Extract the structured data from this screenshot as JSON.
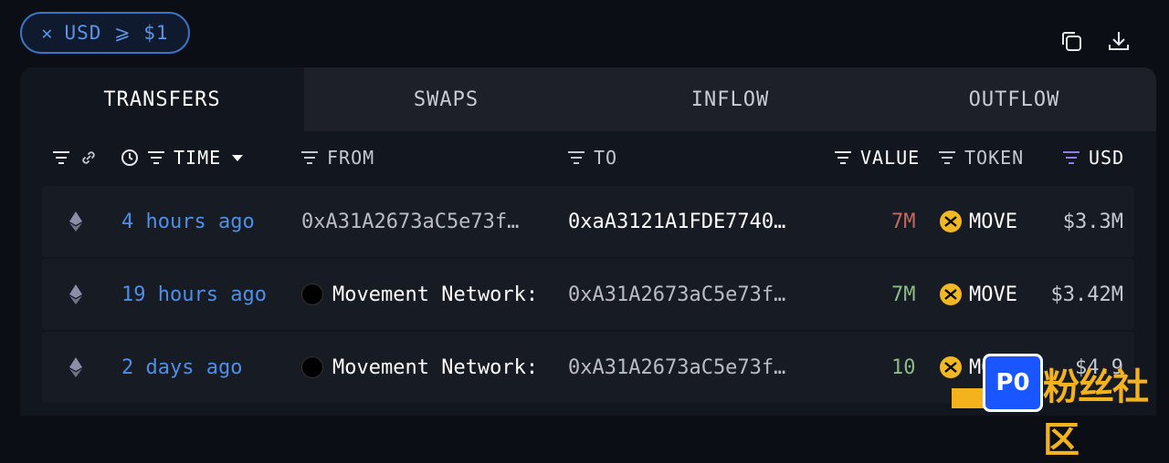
{
  "filter_chip": {
    "label": "USD ⩾ $1",
    "close": "✕"
  },
  "toolbar": {
    "copy_icon": "copy-icon",
    "download_icon": "download-icon"
  },
  "tabs": [
    {
      "label": "TRANSFERS",
      "active": true
    },
    {
      "label": "SWAPS",
      "active": false
    },
    {
      "label": "INFLOW",
      "active": false
    },
    {
      "label": "OUTFLOW",
      "active": false
    }
  ],
  "columns": {
    "time": "TIME",
    "from": "FROM",
    "to": "TO",
    "value": "VALUE",
    "token": "TOKEN",
    "usd": "USD"
  },
  "rows": [
    {
      "chain_icon": "ethereum-icon",
      "time": "4 hours ago",
      "from": "0xA31A2673aC5e73f…",
      "to": "0xaA3121A1FDE7740…",
      "value": "7M",
      "value_color": "#c46a61",
      "token": "MOVE",
      "usd": "$3.3M"
    },
    {
      "chain_icon": "ethereum-icon",
      "time": "19 hours ago",
      "from": "Movement Network:",
      "to": "0xA31A2673aC5e73f…",
      "value": "7M",
      "value_color": "#8dbb86",
      "token": "MOVE",
      "usd": "$3.42M"
    },
    {
      "chain_icon": "ethereum-icon",
      "time": "2 days ago",
      "from": "Movement Network:",
      "to": "0xA31A2673aC5e73f…",
      "value": "10",
      "value_color": "#8dbb86",
      "token": "MOVE",
      "usd": "$4.9"
    }
  ],
  "watermark": {
    "box_text": "P0",
    "text": "粉丝社区"
  }
}
